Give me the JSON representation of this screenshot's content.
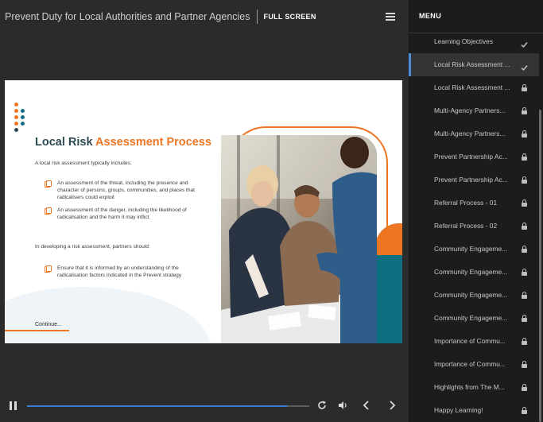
{
  "header": {
    "course_title": "Prevent Duty for Local Authorities and Partner Agencies",
    "fullscreen_label": "FULL SCREEN",
    "menu_icon": "hamburger-icon"
  },
  "slide": {
    "title_part1": "Local Risk ",
    "title_part2": "Assessment Process",
    "intro": "A local risk assessment typically includes:",
    "bullets_1": [
      "An assessment of the threat, including the presence and character of persons, groups, communities, and places that radicalisers could exploit",
      "An assessment of the danger, including the likelihood of radicalisation and the harm it may inflict"
    ],
    "partners_text": "In developing a risk assessment, partners should:",
    "bullets_2": [
      "Ensure that it is informed by an understanding of the radicalisation factors indicated in the Prevent strategy"
    ],
    "continue_label": "Continue...",
    "colors": {
      "orange": "#ee7623",
      "teal": "#0e6f83",
      "navy": "#2d4a52"
    }
  },
  "controls": {
    "progress": 0.92,
    "icons": [
      "pause-icon",
      "replay-icon",
      "volume-icon",
      "previous-icon",
      "next-icon"
    ]
  },
  "menu": {
    "title": "MENU",
    "items": [
      {
        "label": "Learning Objectives",
        "status": "complete"
      },
      {
        "label": "Local Risk Assessment ...",
        "status": "complete",
        "active": true
      },
      {
        "label": "Local Risk Assessment ...",
        "status": "locked"
      },
      {
        "label": "Multi-Agency Partners...",
        "status": "locked"
      },
      {
        "label": "Multi-Agency Partners...",
        "status": "locked"
      },
      {
        "label": "Prevent Partnership Ac...",
        "status": "locked"
      },
      {
        "label": "Prevent Partnership Ac...",
        "status": "locked"
      },
      {
        "label": "Referral Process - 01",
        "status": "locked"
      },
      {
        "label": "Referral Process - 02",
        "status": "locked"
      },
      {
        "label": "Community Engageme...",
        "status": "locked"
      },
      {
        "label": "Community Engageme...",
        "status": "locked"
      },
      {
        "label": "Community Engageme...",
        "status": "locked"
      },
      {
        "label": "Community Engageme...",
        "status": "locked"
      },
      {
        "label": "Importance of Commu...",
        "status": "locked"
      },
      {
        "label": "Importance of Commu...",
        "status": "locked"
      },
      {
        "label": "Highlights from The M...",
        "status": "locked"
      },
      {
        "label": "Happy Learning!",
        "status": "locked"
      }
    ]
  }
}
